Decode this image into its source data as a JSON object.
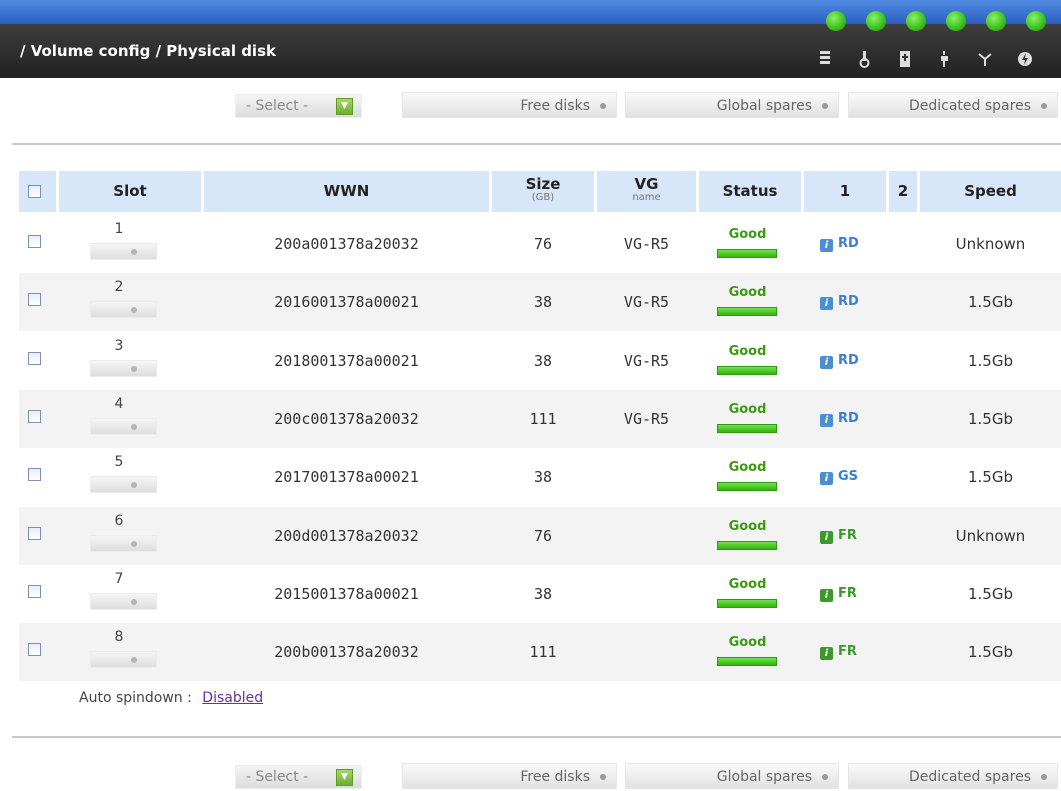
{
  "header": {
    "title": "/ Volume config / Physical disk",
    "leds": [
      "led-1",
      "led-2",
      "led-3",
      "led-4",
      "led-5",
      "led-6"
    ],
    "icons": [
      "disk-stack-icon",
      "temperature-icon",
      "power-supply-icon",
      "voltage-icon",
      "fan-icon",
      "ups-icon"
    ]
  },
  "toolbar": {
    "select_label": "- Select -",
    "free_disks": "Free disks",
    "global_spares": "Global spares",
    "dedicated_spares": "Dedicated spares"
  },
  "table": {
    "headers": {
      "slot": "Slot",
      "wwn": "WWN",
      "size": "Size",
      "size_unit": "(GB)",
      "vg": "VG",
      "vg_sub": "name",
      "status": "Status",
      "col1": "1",
      "col2": "2",
      "speed": "Speed"
    },
    "rows": [
      {
        "slot": "1",
        "wwn": "200a001378a20032",
        "size": "76",
        "vg": "VG-R5",
        "status": "Good",
        "role": "RD",
        "speed": "Unknown"
      },
      {
        "slot": "2",
        "wwn": "2016001378a00021",
        "size": "38",
        "vg": "VG-R5",
        "status": "Good",
        "role": "RD",
        "speed": "1.5Gb"
      },
      {
        "slot": "3",
        "wwn": "2018001378a00021",
        "size": "38",
        "vg": "VG-R5",
        "status": "Good",
        "role": "RD",
        "speed": "1.5Gb"
      },
      {
        "slot": "4",
        "wwn": "200c001378a20032",
        "size": "111",
        "vg": "VG-R5",
        "status": "Good",
        "role": "RD",
        "speed": "1.5Gb"
      },
      {
        "slot": "5",
        "wwn": "2017001378a00021",
        "size": "38",
        "vg": "",
        "status": "Good",
        "role": "GS",
        "speed": "1.5Gb"
      },
      {
        "slot": "6",
        "wwn": "200d001378a20032",
        "size": "76",
        "vg": "",
        "status": "Good",
        "role": "FR",
        "speed": "Unknown"
      },
      {
        "slot": "7",
        "wwn": "2015001378a00021",
        "size": "38",
        "vg": "",
        "status": "Good",
        "role": "FR",
        "speed": "1.5Gb"
      },
      {
        "slot": "8",
        "wwn": "200b001378a20032",
        "size": "111",
        "vg": "",
        "status": "Good",
        "role": "FR",
        "speed": "1.5Gb"
      }
    ]
  },
  "spindown": {
    "label": "Auto spindown :",
    "value": "Disabled"
  },
  "colors": {
    "header_blue": "#2f64c4",
    "header_dark": "#2a2a2a",
    "table_header": "#d7e6f8",
    "good_green": "#3c9a12",
    "role_blue": "#3a7fd0",
    "role_green": "#3b9a2a",
    "link_purple": "#6b2fa3"
  }
}
